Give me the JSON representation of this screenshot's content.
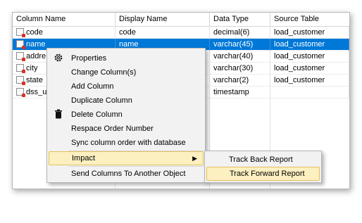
{
  "grid": {
    "columns": [
      "Column Name",
      "Display Name",
      "Data Type",
      "Source Table"
    ],
    "rows": [
      {
        "name": "code",
        "display": "code",
        "type": "decimal(6)",
        "source": "load_customer"
      },
      {
        "name": "name",
        "display": "name",
        "type": "varchar(45)",
        "source": "load_customer"
      },
      {
        "name": "addre",
        "display": "",
        "type": "varchar(40)",
        "source": "load_customer"
      },
      {
        "name": "city",
        "display": "",
        "type": "varchar(30)",
        "source": "load_customer"
      },
      {
        "name": "state",
        "display": "",
        "type": "varchar(2)",
        "source": "load_customer"
      },
      {
        "name": "dss_u",
        "display": "",
        "type": "timestamp",
        "source": ""
      }
    ],
    "selected_row_index": 1
  },
  "context_menu": {
    "items": [
      {
        "label": "Properties",
        "icon": "gear-icon"
      },
      {
        "label": "Change Column(s)",
        "icon": ""
      },
      {
        "label": "Add Column",
        "icon": ""
      },
      {
        "label": "Duplicate Column",
        "icon": ""
      },
      {
        "label": "Delete Column",
        "icon": "trash-icon"
      },
      {
        "label": "Respace Order Number",
        "icon": ""
      },
      {
        "label": "Sync column order with database",
        "icon": ""
      },
      {
        "label": "Impact",
        "icon": "",
        "has_submenu": true,
        "highlighted": true
      },
      {
        "label": "Send Columns To Another Object",
        "icon": ""
      }
    ]
  },
  "submenu": {
    "items": [
      {
        "label": "Track Back Report"
      },
      {
        "label": "Track Forward Report",
        "highlighted": true
      }
    ]
  },
  "colors": {
    "selection": "#0078d7",
    "menu_highlight": "#fcefc0",
    "menu_highlight_border": "#e3c25b"
  }
}
